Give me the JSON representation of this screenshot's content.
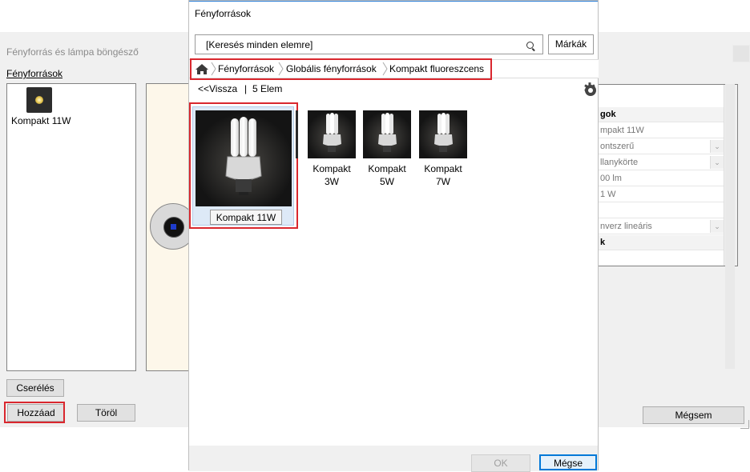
{
  "background_window": {
    "title": "Fényforrás és lámpa böngésző",
    "list_label": "Fényforrások",
    "list_items": [
      {
        "label": "Kompakt 11W"
      }
    ],
    "buttons": {
      "replace": "Cserélés",
      "add": "Hozzáad",
      "delete": "Töröl",
      "cancel": "Mégsem"
    },
    "properties": [
      {
        "text": "gok",
        "header": true
      },
      {
        "text": "mpakt 11W"
      },
      {
        "text": "ontszerű",
        "dropdown": true
      },
      {
        "text": "llanykörte",
        "dropdown": true
      },
      {
        "text": "00 lm"
      },
      {
        "text": "1 W"
      },
      {
        "text": ""
      },
      {
        "text": "nverz lineáris",
        "dropdown": true
      },
      {
        "text": "k",
        "header": true
      },
      {
        "text": ""
      }
    ]
  },
  "dialog": {
    "title": "Fényforrások",
    "search": {
      "placeholder": "[Keresés minden elemre]"
    },
    "brands_button": "Márkák",
    "breadcrumb": [
      "Fényforrások",
      "Globális fényforrások",
      "Kompakt fluoreszcens"
    ],
    "nav": {
      "back": "<<Vissza",
      "separator": "|",
      "count": "5 Elem"
    },
    "items": [
      {
        "label": "Kompakt 11W",
        "selected": true
      },
      {
        "label": "Kompakt 3W"
      },
      {
        "label": "Kompakt 5W"
      },
      {
        "label": "Kompakt 7W"
      }
    ],
    "buttons": {
      "ok": "OK",
      "cancel": "Mégse"
    }
  },
  "colors": {
    "highlight": "#d9272e",
    "accent": "#0078d7",
    "selection": "#dde9f7"
  }
}
